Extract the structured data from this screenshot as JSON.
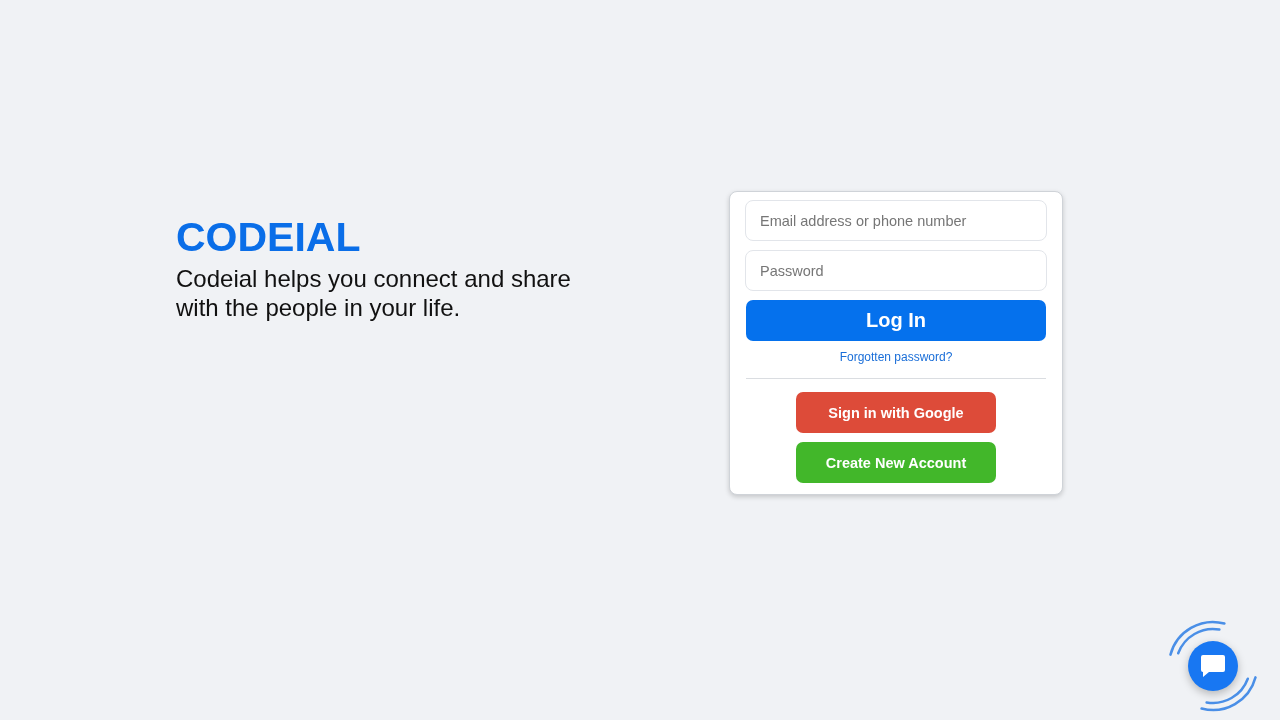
{
  "brand": {
    "logo": "CODEIAL",
    "tagline": "Codeial helps you connect and share with the people in your life."
  },
  "login_form": {
    "fields": [
      {
        "placeholder": "Email address or phone number"
      },
      {
        "placeholder": "Password"
      }
    ],
    "login_button": "Log In",
    "forgot_link": "Forgotten password?",
    "buttons": [
      {
        "label": "Sign in with Google",
        "color": "#dd4b39"
      },
      {
        "label": "Create New Account",
        "color": "#42b72a"
      }
    ]
  }
}
